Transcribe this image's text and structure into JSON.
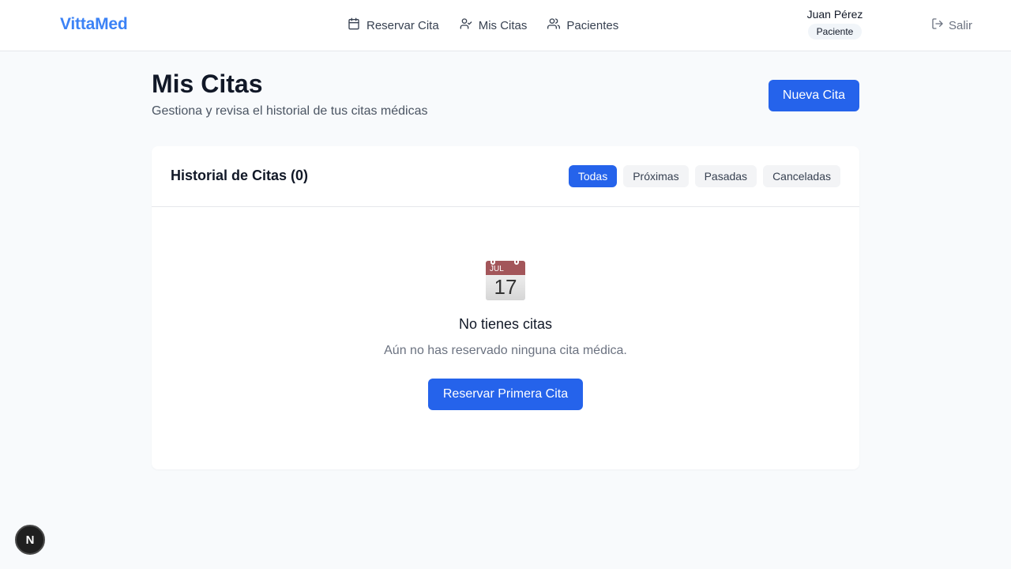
{
  "header": {
    "brand": "VittaMed",
    "nav": [
      {
        "label": "Reservar Cita",
        "icon": "calendar-icon"
      },
      {
        "label": "Mis Citas",
        "icon": "user-check-icon"
      },
      {
        "label": "Pacientes",
        "icon": "users-icon"
      }
    ],
    "user": {
      "name": "Juan Pérez",
      "role": "Paciente"
    },
    "logout_label": "Salir"
  },
  "page": {
    "title": "Mis Citas",
    "subtitle": "Gestiona y revisa el historial de tus citas médicas",
    "new_button": "Nueva Cita"
  },
  "history": {
    "title": "Historial de Citas (0)",
    "filters": [
      {
        "label": "Todas",
        "active": true
      },
      {
        "label": "Próximas",
        "active": false
      },
      {
        "label": "Pasadas",
        "active": false
      },
      {
        "label": "Canceladas",
        "active": false
      }
    ],
    "empty": {
      "icon": "calendar-emoji-icon",
      "calendar_month": "JUL",
      "calendar_day": "17",
      "title": "No tienes citas",
      "text": "Aún no has reservado ninguna cita médica.",
      "button": "Reservar Primera Cita"
    }
  },
  "dev_badge": "N",
  "colors": {
    "brand": "#3b82f6",
    "primary": "#2563eb",
    "background": "#f8fafc"
  }
}
